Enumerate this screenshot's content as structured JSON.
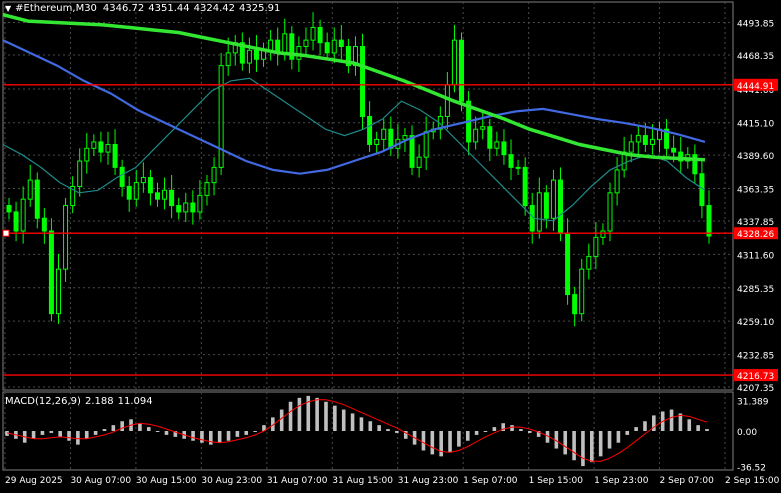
{
  "header": {
    "symbol_tf": "#Ethereum,M30",
    "open": "4346.72",
    "high": "4351.44",
    "low": "4324.42",
    "close": "4325.91"
  },
  "price_axis": {
    "ticks": [
      "4493.85",
      "4468.35",
      "4441.60",
      "4415.10",
      "4389.60",
      "4363.35",
      "4337.85",
      "4311.60",
      "4285.35",
      "4259.10",
      "4232.85",
      "4207.35"
    ],
    "labels": {
      "line_upper": "4444.91",
      "current": "4328.26",
      "line_lower": "4216.73"
    }
  },
  "macd": {
    "label": "MACD(12,26,9)",
    "main": "2.188",
    "signal": "11.094",
    "ticks": [
      "31.389",
      "0.00",
      "-36.52"
    ]
  },
  "time_axis": [
    "29 Aug 2025",
    "30 Aug 07:00",
    "30 Aug 15:00",
    "30 Aug 23:00",
    "31 Aug 07:00",
    "31 Aug 15:00",
    "31 Aug 23:00",
    "1 Sep 07:00",
    "1 Sep 15:00",
    "1 Sep 23:00",
    "2 Sep 07:00",
    "2 Sep 15:00"
  ],
  "colors": {
    "background": "#000000",
    "candles": "#00ff00",
    "grid": "#4a4a4a",
    "ma_fast": "#1f8a8a",
    "ma_mid": "#4169e1",
    "ma_slow": "#32e632",
    "hline": "#ff0000",
    "macd_hist": "#c0c0c0",
    "macd_signal": "#ff0000"
  },
  "chart_data": {
    "type": "candlestick",
    "symbol": "#Ethereum",
    "timeframe": "M30",
    "ylim": [
      4205,
      4510
    ],
    "grid": true,
    "closes": [
      4345,
      4330,
      4355,
      4370,
      4340,
      4330,
      4265,
      4300,
      4350,
      4365,
      4385,
      4395,
      4400,
      4392,
      4398,
      4380,
      4365,
      4355,
      4368,
      4372,
      4360,
      4355,
      4362,
      4350,
      4345,
      4352,
      4345,
      4358,
      4368,
      4380,
      4460,
      4470,
      4478,
      4462,
      4472,
      4465,
      4472,
      4480,
      4470,
      4485,
      4465,
      4475,
      4480,
      4490,
      4478,
      4470,
      4480,
      4475,
      4460,
      4475,
      4420,
      4398,
      4402,
      4410,
      4395,
      4402,
      4405,
      4380,
      4388,
      4408,
      4410,
      4420,
      4445,
      4480,
      4432,
      4400,
      4410,
      4412,
      4395,
      4400,
      4390,
      4380,
      4380,
      4350,
      4330,
      4360,
      4340,
      4370,
      4328,
      4280,
      4265,
      4300,
      4310,
      4325,
      4330,
      4360,
      4378,
      4392,
      4400,
      4405,
      4398,
      4402,
      4410,
      4395,
      4392,
      4385,
      4390,
      4375,
      4350,
      4326
    ],
    "moving_averages": [
      {
        "values": [
          4398,
          4390,
          4380,
          4368,
          4360,
          4362,
          4372,
          4380,
          4395,
          4410,
          4425,
          4440,
          4448,
          4450,
          4440,
          4430,
          4420,
          4410,
          4405,
          4410,
          4418,
          4432,
          4425,
          4415,
          4400,
          4385,
          4370,
          4355,
          4340,
          4338,
          4350,
          4365,
          4378,
          4385,
          4390,
          4385,
          4372,
          4362
        ]
      },
      {
        "values": [
          4480,
          4470,
          4460,
          4448,
          4438,
          4425,
          4415,
          4405,
          4395,
          4385,
          4378,
          4375,
          4378,
          4385,
          4392,
          4402,
          4410,
          4415,
          4420,
          4424,
          4426,
          4422,
          4418,
          4415,
          4411,
          4406,
          4400
        ]
      },
      {
        "values": [
          4500,
          4495,
          4494,
          4493,
          4492,
          4490,
          4488,
          4486,
          4482,
          4478,
          4474,
          4470,
          4468,
          4465,
          4462,
          4455,
          4448,
          4440,
          4432,
          4425,
          4418,
          4410,
          4404,
          4398,
          4394,
          4390,
          4388,
          4387,
          4386
        ]
      }
    ],
    "horizontal_lines": [
      4444.91,
      4328.26,
      4216.73
    ],
    "macd": {
      "ylim": [
        -40,
        40
      ],
      "histogram": [
        -5,
        -8,
        -12,
        -8,
        -4,
        -2,
        -6,
        -10,
        -14,
        -8,
        -4,
        2,
        6,
        10,
        12,
        8,
        4,
        0,
        -4,
        -6,
        -8,
        -10,
        -12,
        -14,
        -12,
        -10,
        -6,
        -4,
        0,
        6,
        14,
        22,
        30,
        34,
        36,
        34,
        30,
        26,
        22,
        18,
        14,
        10,
        6,
        2,
        -2,
        -8,
        -14,
        -20,
        -24,
        -26,
        -22,
        -16,
        -10,
        -4,
        0,
        4,
        8,
        6,
        2,
        -2,
        -6,
        -12,
        -18,
        -24,
        -30,
        -36,
        -32,
        -26,
        -18,
        -12,
        -4,
        4,
        10,
        16,
        20,
        22,
        18,
        12,
        6,
        2
      ],
      "signal": [
        -2,
        -4,
        -6,
        -8,
        -8,
        -7,
        -6,
        -7,
        -8,
        -8,
        -6,
        -4,
        -1,
        3,
        6,
        8,
        7,
        5,
        2,
        -1,
        -4,
        -7,
        -9,
        -11,
        -12,
        -11,
        -9,
        -7,
        -4,
        0,
        6,
        13,
        20,
        26,
        30,
        32,
        32,
        30,
        27,
        23,
        19,
        15,
        11,
        7,
        3,
        -2,
        -7,
        -12,
        -17,
        -21,
        -22,
        -20,
        -16,
        -11,
        -6,
        -2,
        2,
        4,
        4,
        2,
        -1,
        -5,
        -10,
        -16,
        -22,
        -28,
        -31,
        -31,
        -28,
        -23,
        -17,
        -10,
        -3,
        4,
        10,
        14,
        16,
        15,
        12,
        9
      ]
    }
  }
}
